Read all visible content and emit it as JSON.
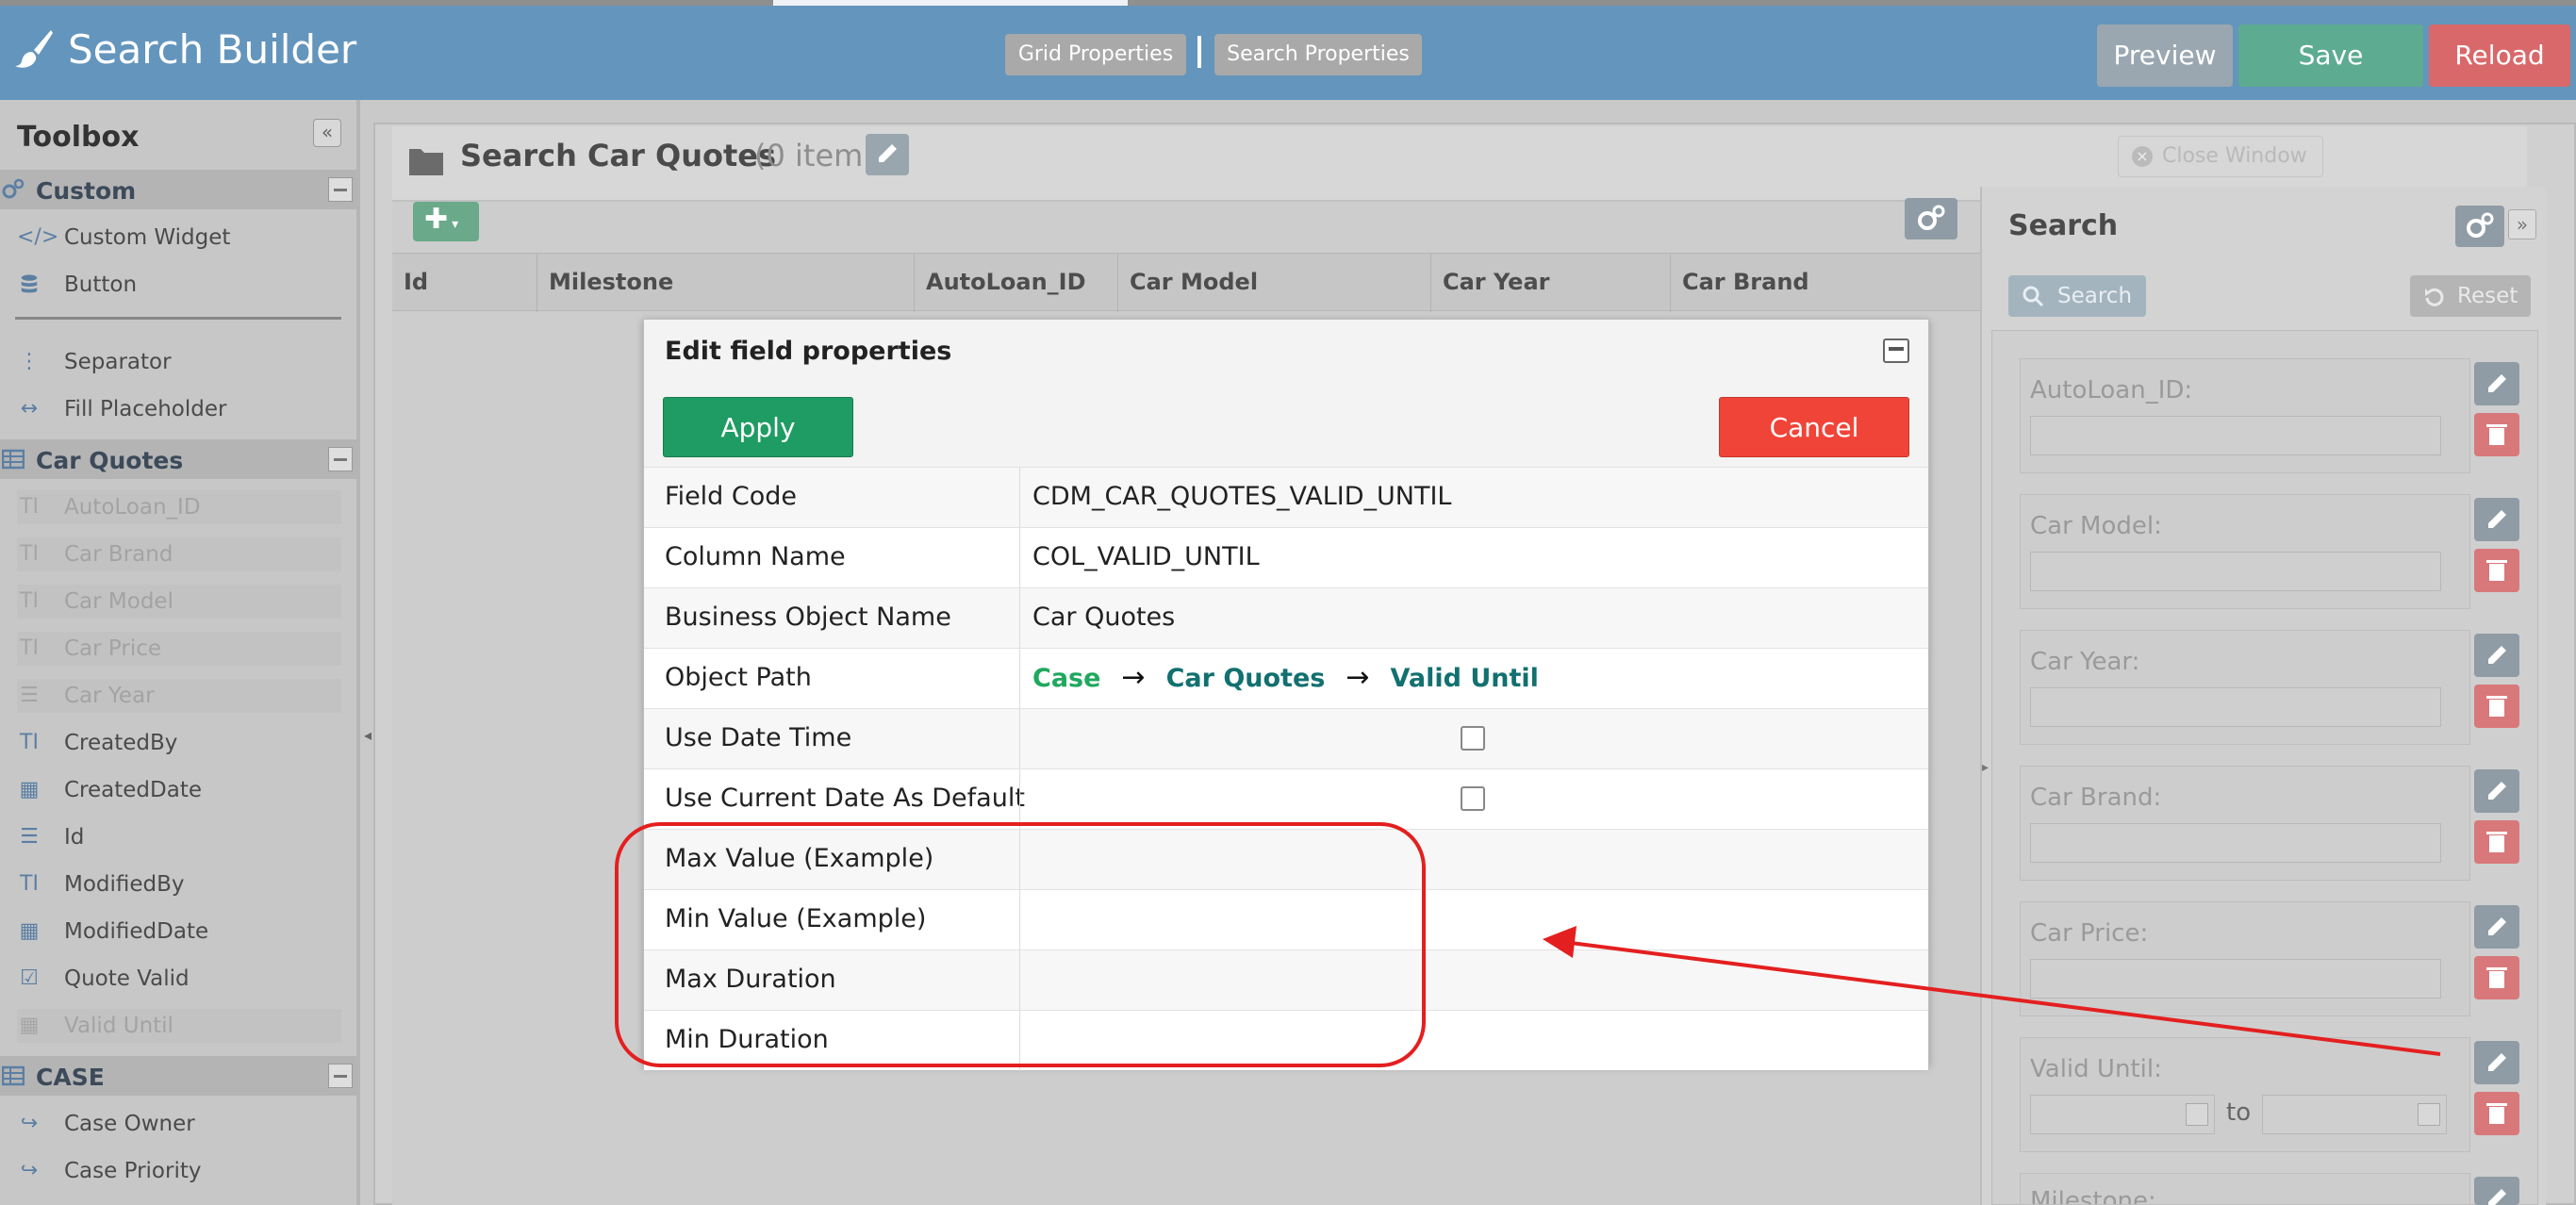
{
  "app": {
    "title": "Search Builder",
    "tabs": [
      "Grid Properties",
      "Search Properties"
    ],
    "preview_label": "Preview",
    "save_label": "Save",
    "reload_label": "Reload"
  },
  "colors": {
    "header": "#6495bc",
    "apply": "#1f9c63",
    "cancel": "#f04438",
    "annotation": "#e41f1f",
    "path_case": "#1fa85e",
    "path_link": "#127070"
  },
  "toolbox": {
    "title": "Toolbox",
    "sections": [
      {
        "label": "Custom",
        "icon": "gears-icon",
        "items": [
          {
            "label": "Custom Widget",
            "icon": "code-icon",
            "disabled": false
          },
          {
            "label": "Button",
            "icon": "database-icon",
            "disabled": false
          },
          {
            "label": "Separator",
            "icon": "vertical-dots-icon",
            "disabled": false
          },
          {
            "label": "Fill Placeholder",
            "icon": "horizontal-arrows-icon",
            "disabled": false
          }
        ]
      },
      {
        "label": "Car Quotes",
        "icon": "table-icon",
        "items": [
          {
            "label": "AutoLoan_ID",
            "icon": "text-icon",
            "disabled": true
          },
          {
            "label": "Car Brand",
            "icon": "text-icon",
            "disabled": true
          },
          {
            "label": "Car Model",
            "icon": "text-icon",
            "disabled": true
          },
          {
            "label": "Car Price",
            "icon": "text-icon",
            "disabled": true
          },
          {
            "label": "Car Year",
            "icon": "list-icon",
            "disabled": true
          },
          {
            "label": "CreatedBy",
            "icon": "text-icon",
            "disabled": false
          },
          {
            "label": "CreatedDate",
            "icon": "calendar-icon",
            "disabled": false
          },
          {
            "label": "Id",
            "icon": "list-icon",
            "disabled": false
          },
          {
            "label": "ModifiedBy",
            "icon": "text-icon",
            "disabled": false
          },
          {
            "label": "ModifiedDate",
            "icon": "calendar-icon",
            "disabled": false
          },
          {
            "label": "Quote Valid",
            "icon": "checkbox-icon",
            "disabled": false
          },
          {
            "label": "Valid Until",
            "icon": "calendar-icon",
            "disabled": true
          }
        ]
      },
      {
        "label": "CASE",
        "icon": "table-icon",
        "items": [
          {
            "label": "Case Owner",
            "icon": "share-arrow-icon",
            "disabled": false
          },
          {
            "label": "Case Priority",
            "icon": "share-arrow-icon",
            "disabled": false
          }
        ]
      }
    ]
  },
  "panel": {
    "title": "Search Car Quotes",
    "count": "(0 item)",
    "close_window": "Close Window",
    "columns": [
      "Id",
      "Milestone",
      "AutoLoan_ID",
      "Car Model",
      "Car Year",
      "Car Brand"
    ]
  },
  "search_panel": {
    "title": "Search",
    "search_label": "Search",
    "reset_label": "Reset",
    "fields": [
      "AutoLoan_ID:",
      "Car Model:",
      "Car Year:",
      "Car Brand:",
      "Car Price:",
      "Valid Until:",
      "Milestone:"
    ],
    "to_label": "to"
  },
  "modal": {
    "title": "Edit field properties",
    "apply_label": "Apply",
    "cancel_label": "Cancel",
    "rows": [
      {
        "name": "Field Code",
        "value": "CDM_CAR_QUOTES_VALID_UNTIL"
      },
      {
        "name": "Column Name",
        "value": "COL_VALID_UNTIL"
      },
      {
        "name": "Business Object Name",
        "value": "Car Quotes"
      },
      {
        "name": "Object Path",
        "path": [
          "Case",
          "Car Quotes",
          "Valid Until"
        ]
      },
      {
        "name": "Use Date Time",
        "checked": false
      },
      {
        "name": "Use Current Date As Default",
        "checked": false
      },
      {
        "name": "Max Value (Example)",
        "value": ""
      },
      {
        "name": "Min Value (Example)",
        "value": ""
      },
      {
        "name": "Max Duration",
        "value": ""
      },
      {
        "name": "Min Duration",
        "value": ""
      }
    ]
  }
}
